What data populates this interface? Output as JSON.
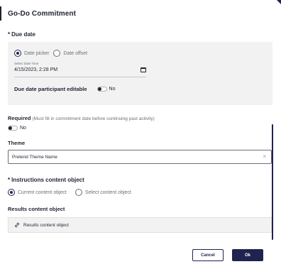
{
  "dialog": {
    "title": "Go-Do Commitment"
  },
  "due_date": {
    "required_star": "*",
    "label": "Due date",
    "options": [
      "Date picker",
      "Date offset"
    ],
    "selected_option": "Date picker",
    "datetime_field": {
      "label": "Select Date Time",
      "value": "4/15/2023, 2:28 PM"
    },
    "participant_editable": {
      "label": "Due date participant editable",
      "toggle_text": "No",
      "enabled": false
    }
  },
  "required": {
    "label": "Required",
    "hint": "(Must fill in commitment date before continuing past activity)",
    "toggle_text": "No",
    "enabled": false
  },
  "theme": {
    "label": "Theme",
    "value": "Pretend Theme Name",
    "clear_glyph": "×"
  },
  "instructions": {
    "required_star": "*",
    "label": "Instructions content object",
    "options": [
      "Current content object",
      "Select content object"
    ],
    "selected_option": "Current content object"
  },
  "results": {
    "label": "Results content object",
    "value": "Results content object"
  },
  "buttons": {
    "cancel": "Cancel",
    "ok": "Ok"
  },
  "colors": {
    "primary": "#1f2350",
    "panel": "#f2f2f2",
    "text": "#1f2433",
    "muted": "#6b6f78"
  },
  "icons": [
    "calendar-icon",
    "clear-icon",
    "link-icon",
    "radio-selected",
    "radio-unselected",
    "toggle-switch"
  ]
}
